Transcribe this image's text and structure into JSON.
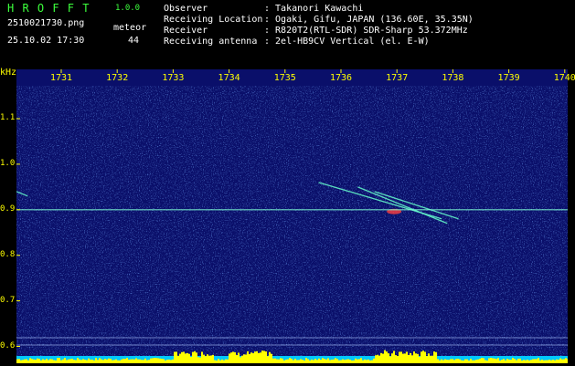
{
  "header": {
    "app_title": "H R O F F T",
    "version": "1.0.0",
    "filename": "2510021730.png",
    "datetime": "25.10.02 17:30",
    "meteor_label": "meteor",
    "meteor_count": "44"
  },
  "info": [
    {
      "key": "Observer",
      "value": ": Takanori Kawachi"
    },
    {
      "key": "Receiving Location",
      "value": ": Ogaki, Gifu, JAPAN (136.60E, 35.35N)"
    },
    {
      "key": "Receiver",
      "value": ": R820T2(RTL-SDR) SDR-Sharp 53.372MHz"
    },
    {
      "key": "Receiving antenna",
      "value": ": 2el-HB9CV Vertical (el. E-W)"
    }
  ],
  "axis": {
    "unit": "kHz",
    "time_ticks": [
      "1731",
      "1732",
      "1733",
      "1734",
      "1735",
      "1736",
      "1737",
      "1738",
      "1739",
      "1740"
    ],
    "freq_ticks": [
      "1.1",
      "1.0",
      "0.9",
      "0.8",
      "0.7",
      "0.6"
    ]
  },
  "colors": {
    "spectrogram_bg": "#0a0f6a",
    "axis_labels": "#ffff00",
    "title": "#3cff3c",
    "signal_line": "#7fffd4",
    "power_bar": "#ffff00"
  },
  "chart_data": {
    "type": "heatmap",
    "x_ticks": [
      "1731",
      "1732",
      "1733",
      "1734",
      "1735",
      "1736",
      "1737",
      "1738",
      "1739",
      "1740"
    ],
    "y_ticks": [
      1.1,
      1.0,
      0.9,
      0.8,
      0.7,
      0.6
    ],
    "ylabel": "kHz",
    "ylim": [
      0.58,
      1.19
    ],
    "carrier_khz": 0.9,
    "meteor_echoes": [
      {
        "t_start": "1735.6",
        "t_end": "1737.8",
        "f_start": 0.96,
        "f_end": 0.88
      },
      {
        "t_start": "1736.3",
        "t_end": "1737.9",
        "f_start": 0.95,
        "f_end": 0.87
      },
      {
        "t_start": "1736.6",
        "t_end": "1738.1",
        "f_start": 0.94,
        "f_end": 0.88
      },
      {
        "t_start": "1730.0",
        "t_end": "1730.4",
        "f_start": 0.94,
        "f_end": 0.93
      }
    ]
  }
}
